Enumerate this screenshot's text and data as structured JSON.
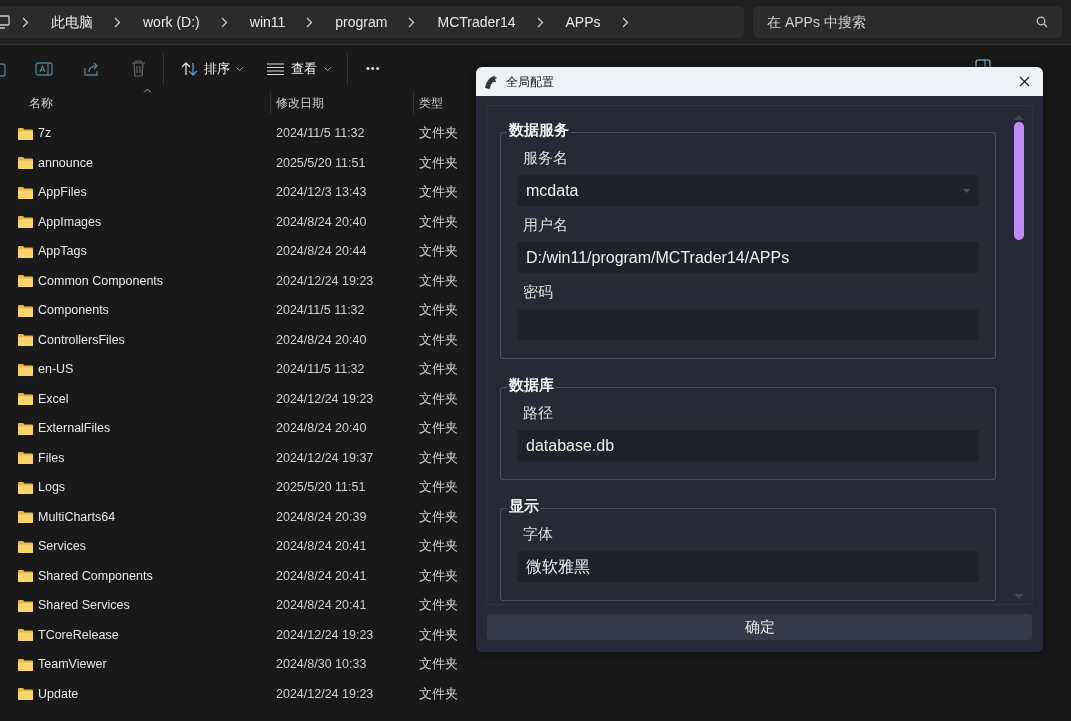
{
  "breadcrumbs": [
    "此电脑",
    "work (D:)",
    "win11",
    "program",
    "MCTrader14",
    "APPs"
  ],
  "search": {
    "placeholder": "在 APPs 中搜索"
  },
  "toolbar": {
    "sort": "排序",
    "view": "查看",
    "more": "•••"
  },
  "columns": [
    "名称",
    "修改日期",
    "类型"
  ],
  "rows": [
    {
      "name": "7z",
      "date": "2024/11/5 11:32",
      "type": "文件夹"
    },
    {
      "name": "announce",
      "date": "2025/5/20 11:51",
      "type": "文件夹"
    },
    {
      "name": "AppFiles",
      "date": "2024/12/3 13:43",
      "type": "文件夹"
    },
    {
      "name": "AppImages",
      "date": "2024/8/24 20:40",
      "type": "文件夹"
    },
    {
      "name": "AppTags",
      "date": "2024/8/24 20:44",
      "type": "文件夹"
    },
    {
      "name": "Common Components",
      "date": "2024/12/24 19:23",
      "type": "文件夹"
    },
    {
      "name": "Components",
      "date": "2024/11/5 11:32",
      "type": "文件夹"
    },
    {
      "name": "ControllersFiles",
      "date": "2024/8/24 20:40",
      "type": "文件夹"
    },
    {
      "name": "en-US",
      "date": "2024/11/5 11:32",
      "type": "文件夹"
    },
    {
      "name": "Excel",
      "date": "2024/12/24 19:23",
      "type": "文件夹"
    },
    {
      "name": "ExternalFiles",
      "date": "2024/8/24 20:40",
      "type": "文件夹"
    },
    {
      "name": "Files",
      "date": "2024/12/24 19:37",
      "type": "文件夹"
    },
    {
      "name": "Logs",
      "date": "2025/5/20 11:51",
      "type": "文件夹"
    },
    {
      "name": "MultiCharts64",
      "date": "2024/8/24 20:39",
      "type": "文件夹"
    },
    {
      "name": "Services",
      "date": "2024/8/24 20:41",
      "type": "文件夹"
    },
    {
      "name": "Shared Components",
      "date": "2024/8/24 20:41",
      "type": "文件夹"
    },
    {
      "name": "Shared Services",
      "date": "2024/8/24 20:41",
      "type": "文件夹"
    },
    {
      "name": "TCoreRelease",
      "date": "2024/12/24 19:23",
      "type": "文件夹"
    },
    {
      "name": "TeamViewer",
      "date": "2024/8/30 10:33",
      "type": "文件夹"
    },
    {
      "name": "Update",
      "date": "2024/12/24 19:23",
      "type": "文件夹"
    }
  ],
  "dialog": {
    "title": "全局配置",
    "ok": "确定",
    "groups": [
      {
        "title": "数据服务",
        "fields": [
          {
            "label": "服务名",
            "kind": "select",
            "value": "mcdata"
          },
          {
            "label": "用户名",
            "kind": "text",
            "value": "D:/win11/program/MCTrader14/APPs"
          },
          {
            "label": "密码",
            "kind": "text"
          }
        ]
      },
      {
        "title": "数据库",
        "fields": [
          {
            "label": "路径",
            "kind": "text",
            "value": "database.db"
          }
        ]
      },
      {
        "title": "显示",
        "fields": [
          {
            "label": "字体",
            "kind": "text",
            "value": "微软雅黑"
          }
        ]
      }
    ]
  }
}
